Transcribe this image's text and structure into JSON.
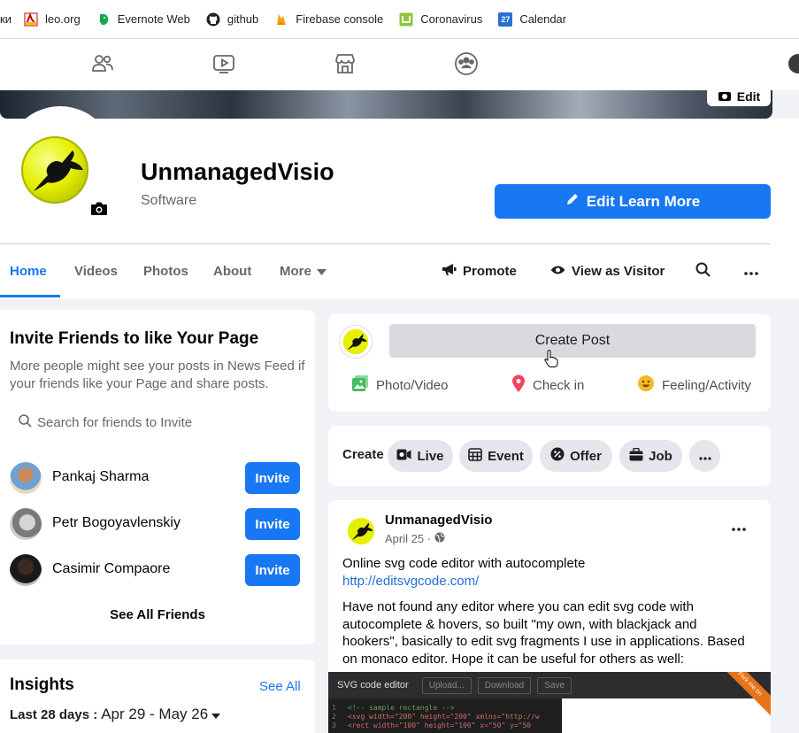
{
  "bookmarks": [
    {
      "label": "ки",
      "icon": "cut-off-item"
    },
    {
      "label": "leo.org",
      "icon": "leo-icon"
    },
    {
      "label": "Evernote Web",
      "icon": "evernote-icon"
    },
    {
      "label": "github",
      "icon": "github-icon"
    },
    {
      "label": "Firebase console",
      "icon": "firebase-icon"
    },
    {
      "label": "Coronavirus",
      "icon": "coronavirus-icon"
    },
    {
      "label": "Calendar",
      "icon": "calendar-icon",
      "badge": "27"
    }
  ],
  "topnav": {
    "icons": [
      "friends-icon",
      "watch-icon",
      "marketplace-icon",
      "groups-icon"
    ]
  },
  "cover": {
    "edit_label": "Edit"
  },
  "page": {
    "name": "UnmanagedVisio",
    "category": "Software",
    "edit_button": "Edit Learn More"
  },
  "tabs": [
    {
      "label": "Home",
      "active": true
    },
    {
      "label": "Videos"
    },
    {
      "label": "Photos"
    },
    {
      "label": "About"
    },
    {
      "label": "More"
    }
  ],
  "actions": {
    "promote": "Promote",
    "view_as_visitor": "View as Visitor"
  },
  "invite": {
    "title": "Invite Friends to like Your Page",
    "subtitle": "More people might see your posts in News Feed if your friends like your Page and share posts.",
    "search_placeholder": "Search for friends to Invite",
    "friends": [
      {
        "name": "Pankaj Sharma",
        "button": "Invite"
      },
      {
        "name": "Petr Bogoyavlenskiy",
        "button": "Invite"
      },
      {
        "name": "Casimir Compaore",
        "button": "Invite"
      }
    ],
    "see_all": "See All Friends"
  },
  "insights": {
    "title": "Insights",
    "see_all": "See All",
    "period_label": "Last 28 days :",
    "period_dates": "Apr 29 - May 26"
  },
  "create_post": {
    "button": "Create Post",
    "actions": [
      {
        "label": "Photo/Video",
        "icon": "photo-video-icon",
        "color": "#45bd62"
      },
      {
        "label": "Check in",
        "icon": "check-in-icon",
        "color": "#f3425f"
      },
      {
        "label": "Feeling/Activity",
        "icon": "feeling-icon",
        "color": "#f7b928"
      }
    ]
  },
  "create_tools": {
    "label": "Create",
    "items": [
      {
        "label": "Live",
        "icon": "live-icon"
      },
      {
        "label": "Event",
        "icon": "event-icon"
      },
      {
        "label": "Offer",
        "icon": "offer-icon"
      },
      {
        "label": "Job",
        "icon": "job-icon"
      }
    ]
  },
  "post": {
    "author": "UnmanagedVisio",
    "date": "April 25 ·",
    "line1": "Online svg code editor with autocomplete",
    "link": "http://editsvgcode.com/",
    "body": "Have not found any editor where you can edit svg code with autocomplete & hovers, so built \"my own, with blackjack and hookers\", basically to edit svg fragments I use in applications. Based on monaco editor. Hope it can be useful for others as well:",
    "screenshot": {
      "title": "SVG code editor",
      "buttons": [
        "Upload...",
        "Download",
        "Save"
      ],
      "ribbon": "Fork me on",
      "lines": [
        "<!-- sample rectangle -->",
        "<svg width=\"200\" height=\"200\" xmlns=\"http://w",
        "  <rect width=\"100\" height=\"100\" x=\"50\" y=\"50"
      ],
      "line_numbers": [
        "1",
        "2",
        "3"
      ]
    }
  },
  "colors": {
    "primary": "#1877f2",
    "background": "#f0f2f5",
    "secondary_text": "#65676b"
  }
}
